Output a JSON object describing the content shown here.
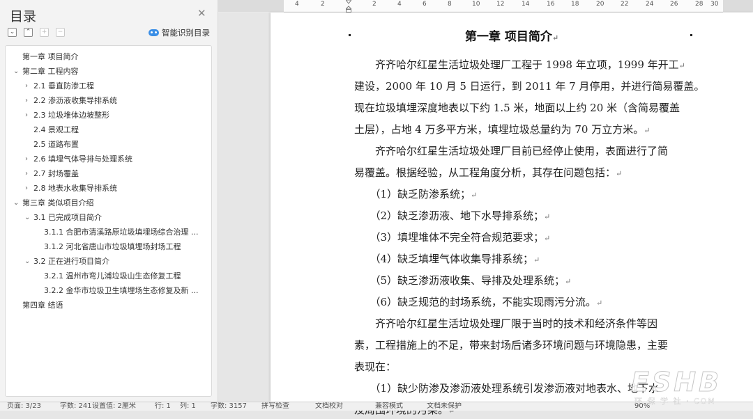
{
  "toc_panel": {
    "title": "目录",
    "smart_toc_label": "智能识别目录",
    "items": [
      {
        "text": "第一章  项目简介",
        "expander": false
      },
      {
        "text": "第二章  工程内容",
        "expander": true
      },
      {
        "text": "2.1 垂直防渗工程",
        "expander": true
      },
      {
        "text": "2.2  渗沥液收集导排系统",
        "expander": true
      },
      {
        "text": "2.3 垃圾堆体边坡整形",
        "expander": true
      },
      {
        "text": "2.4 景观工程",
        "expander": false
      },
      {
        "text": "2.5 道路布置",
        "expander": false
      },
      {
        "text": "2.6  填埋气体导排与处理系统",
        "expander": true
      },
      {
        "text": "2.7  封场覆盖",
        "expander": true
      },
      {
        "text": "2.8  地表水收集导排系统",
        "expander": true
      },
      {
        "text": "第三章  类似项目介绍",
        "expander": true
      },
      {
        "text": "3.1 已完成项目简介",
        "expander": true
      },
      {
        "text": "3.1.1 合肥市清溪路原垃圾填埋场综合治理 ...",
        "expander": false
      },
      {
        "text": "3.1.2 河北省唐山市垃圾填埋场封场工程",
        "expander": false
      },
      {
        "text": "3.2 正在进行项目简介",
        "expander": true
      },
      {
        "text": "3.2.1 温州市弯儿浦垃圾山生态修复工程",
        "expander": false
      },
      {
        "text": "3.2.2 金华市垃圾卫生填埋场生态修复及新 ...",
        "expander": false
      },
      {
        "text": "第四章  结语",
        "expander": false
      }
    ]
  },
  "ruler": {
    "labels": [
      "4",
      "2",
      "2",
      "4",
      "6",
      "8",
      "10",
      "12",
      "14",
      "16",
      "18",
      "20",
      "22",
      "24",
      "26",
      "28",
      "30"
    ]
  },
  "document": {
    "heading": "第一章  项目简介",
    "lines": [
      "　　齐齐哈尔红星生活垃圾处理厂工程于 1998 年立项，1999 年开工",
      "建设，2000 年 10 月 5 日运行，到 2011 年 7 月停用，并进行简易覆盖。",
      "现在垃圾填埋深度地表以下约 1.5 米，地面以上约 20 米（含简易覆盖",
      "土层），占地 4 万多平方米，填埋垃圾总量约为 70 万立方米。",
      "　　齐齐哈尔红星生活垃圾处理厂目前已经停止使用，表面进行了简",
      "易覆盖。根据经验，从工程角度分析，其存在问题包括：",
      "　　（1）缺乏防渗系统；",
      "　　（2）缺乏渗沥液、地下水导排系统；",
      "　　（3）填埋堆体不完全符合规范要求；",
      "　　（4）缺乏填埋气体收集导排系统；",
      "　　（5）缺乏渗沥液收集、导排及处理系统；",
      "　　（6）缺乏规范的封场系统，不能实现雨污分流。",
      "　　齐齐哈尔红星生活垃圾处理厂限于当时的技术和经济条件等因",
      "素，工程措施上的不足，带来封场后诸多环境问题与环境隐患，主要",
      "表现在：",
      "　　（1）缺少防渗及渗沥液处理系统引发渗沥液对地表水、地下水",
      "及周围环境的污染。"
    ],
    "paragraph_marks": [
      true,
      false,
      false,
      true,
      false,
      true,
      true,
      true,
      true,
      true,
      true,
      true,
      false,
      false,
      false,
      false,
      true
    ]
  },
  "status_bar": {
    "items": [
      "页面: 3/23",
      "字数: 241",
      "设置值: 2厘米",
      "行: 1",
      "列: 1",
      "字数: 3157",
      "拼写检查",
      "文档校对",
      "兼容模式",
      "文档未保护",
      "90%"
    ]
  },
  "watermark": {
    "logo": "ESHB",
    "subtitle": "环 保 学 社 · COM"
  },
  "colors": {
    "accent": "#3a8ee6",
    "pane_bg": "#f3f3f3",
    "page_bg": "#ffffff"
  }
}
